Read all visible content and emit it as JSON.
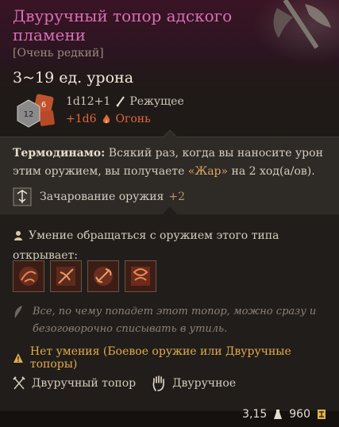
{
  "item": {
    "title": "Двуручный топор адского пламени",
    "rarity": "[Очень редкий]",
    "damage": "3~19 ед. урона",
    "dice": {
      "big_die_label": "12",
      "small_die_label": "6",
      "line1_dice": "1d12+1",
      "line1_type": "Режущее",
      "line2_dice": "+1d6",
      "line2_type": "Огонь"
    }
  },
  "passive": {
    "name": "Термодинамо:",
    "text_before": " Всякий раз, когда вы наносите урон этим оружием, вы получаете ",
    "highlight": "«Жар»",
    "text_after": " на 2 ход(а/ов)."
  },
  "enchantment": {
    "label": "Зачарование оружия",
    "bonus": "+2"
  },
  "proficiency": {
    "text": "Умение обращаться с оружием этого типа открывает:",
    "actions": [
      "action-1-icon",
      "action-2-icon",
      "action-3-icon",
      "action-4-icon"
    ]
  },
  "flavor": "Все, по чему попадет этот топор, можно сразу и безоговорочно списывать в утиль.",
  "warning": "Нет умения (Боевое оружие или Двуручные топоры)",
  "properties": [
    {
      "label": "Двуручный топор",
      "icon": "axe-icon"
    },
    {
      "label": "Двуручное",
      "icon": "hand-icon"
    }
  ],
  "footer": {
    "weight": "3,15",
    "price": "960"
  },
  "colors": {
    "title": "#d96fb6",
    "fire": "#e0683a",
    "warning": "#e1ac4d",
    "highlight": "#d9a766"
  }
}
